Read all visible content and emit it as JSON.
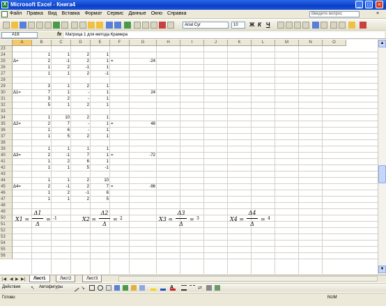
{
  "window": {
    "title": "Microsoft Excel - Книга4",
    "app_icon": "excel-icon"
  },
  "menu": {
    "items": [
      "Файл",
      "Правка",
      "Вид",
      "Вставка",
      "Формат",
      "Сервис",
      "Данные",
      "Окно",
      "Справка"
    ],
    "help_placeholder": "Введите вопрос"
  },
  "toolbar": {
    "font": "Arial Cyr",
    "size": "10"
  },
  "formula_bar": {
    "name_box": "A16",
    "fx": "fx",
    "content": "Матрица 1 для метода Крамера"
  },
  "columns": [
    "A",
    "B",
    "C",
    "D",
    "E",
    "F",
    "G",
    "H",
    "I",
    "J",
    "K",
    "L",
    "M",
    "N",
    "O"
  ],
  "rows": [
    "23",
    "24",
    "25",
    "26",
    "27",
    "28",
    "29",
    "30",
    "31",
    "32",
    "33",
    "34",
    "35",
    "36",
    "37",
    "38",
    "39",
    "40",
    "41",
    "42",
    "43",
    "44",
    "45",
    "46",
    "47",
    "48",
    "49",
    "50",
    "51",
    "52",
    "53",
    "54",
    "55",
    "56"
  ],
  "cells": [
    {
      "r": 1,
      "c": 1,
      "v": "1"
    },
    {
      "r": 1,
      "c": 2,
      "v": "1"
    },
    {
      "r": 1,
      "c": 3,
      "v": "2"
    },
    {
      "r": 1,
      "c": 4,
      "v": "1"
    },
    {
      "r": 2,
      "c": 0,
      "v": "Δ="
    },
    {
      "r": 2,
      "c": 1,
      "v": "2"
    },
    {
      "r": 2,
      "c": 2,
      "v": "-1"
    },
    {
      "r": 2,
      "c": 3,
      "v": "2"
    },
    {
      "r": 2,
      "c": 4,
      "v": "1"
    },
    {
      "r": 2,
      "c": 5,
      "v": "="
    },
    {
      "r": 2,
      "c": 6,
      "v": "-24"
    },
    {
      "r": 3,
      "c": 1,
      "v": "1"
    },
    {
      "r": 3,
      "c": 2,
      "v": "2"
    },
    {
      "r": 3,
      "c": 3,
      "v": "-1"
    },
    {
      "r": 3,
      "c": 4,
      "v": "1"
    },
    {
      "r": 4,
      "c": 1,
      "v": "1"
    },
    {
      "r": 4,
      "c": 2,
      "v": "1"
    },
    {
      "r": 4,
      "c": 3,
      "v": "2"
    },
    {
      "r": 4,
      "c": 4,
      "v": "-1"
    },
    {
      "r": 6,
      "c": 1,
      "v": "3"
    },
    {
      "r": 6,
      "c": 2,
      "v": "1"
    },
    {
      "r": 6,
      "c": 3,
      "v": "2"
    },
    {
      "r": 6,
      "c": 4,
      "v": "1"
    },
    {
      "r": 7,
      "c": 0,
      "v": "Δ1="
    },
    {
      "r": 7,
      "c": 1,
      "v": "7"
    },
    {
      "r": 7,
      "c": 2,
      "v": "1"
    },
    {
      "r": 7,
      "c": 3,
      "v": "-"
    },
    {
      "r": 7,
      "c": 4,
      "v": "1"
    },
    {
      "r": 7,
      "c": 6,
      "v": "24"
    },
    {
      "r": 8,
      "c": 1,
      "v": "3"
    },
    {
      "r": 8,
      "c": 2,
      "v": "2"
    },
    {
      "r": 8,
      "c": 3,
      "v": "-"
    },
    {
      "r": 8,
      "c": 4,
      "v": "1"
    },
    {
      "r": 9,
      "c": 1,
      "v": "5"
    },
    {
      "r": 9,
      "c": 2,
      "v": "1"
    },
    {
      "r": 9,
      "c": 3,
      "v": "2"
    },
    {
      "r": 9,
      "c": 4,
      "v": "1"
    },
    {
      "r": 11,
      "c": 1,
      "v": "1"
    },
    {
      "r": 11,
      "c": 2,
      "v": "10"
    },
    {
      "r": 11,
      "c": 3,
      "v": "2"
    },
    {
      "r": 11,
      "c": 4,
      "v": "1"
    },
    {
      "r": 12,
      "c": 0,
      "v": "Δ2="
    },
    {
      "r": 12,
      "c": 1,
      "v": "2"
    },
    {
      "r": 12,
      "c": 2,
      "v": "7"
    },
    {
      "r": 12,
      "c": 3,
      "v": "-"
    },
    {
      "r": 12,
      "c": 4,
      "v": "1"
    },
    {
      "r": 12,
      "c": 5,
      "v": "="
    },
    {
      "r": 12,
      "c": 6,
      "v": "48"
    },
    {
      "r": 13,
      "c": 1,
      "v": "1"
    },
    {
      "r": 13,
      "c": 2,
      "v": "6"
    },
    {
      "r": 13,
      "c": 3,
      "v": "-"
    },
    {
      "r": 13,
      "c": 4,
      "v": "1"
    },
    {
      "r": 14,
      "c": 1,
      "v": "1"
    },
    {
      "r": 14,
      "c": 2,
      "v": "5"
    },
    {
      "r": 14,
      "c": 3,
      "v": "2"
    },
    {
      "r": 14,
      "c": 4,
      "v": "1"
    },
    {
      "r": 16,
      "c": 1,
      "v": "1"
    },
    {
      "r": 16,
      "c": 2,
      "v": "1"
    },
    {
      "r": 16,
      "c": 3,
      "v": "1"
    },
    {
      "r": 16,
      "c": 4,
      "v": "1"
    },
    {
      "r": 17,
      "c": 0,
      "v": "Δ3="
    },
    {
      "r": 17,
      "c": 1,
      "v": "2"
    },
    {
      "r": 17,
      "c": 2,
      "v": "-1"
    },
    {
      "r": 17,
      "c": 3,
      "v": "7"
    },
    {
      "r": 17,
      "c": 4,
      "v": "1"
    },
    {
      "r": 17,
      "c": 5,
      "v": "="
    },
    {
      "r": 17,
      "c": 6,
      "v": "-72"
    },
    {
      "r": 18,
      "c": 1,
      "v": "1"
    },
    {
      "r": 18,
      "c": 2,
      "v": "2"
    },
    {
      "r": 18,
      "c": 3,
      "v": "6"
    },
    {
      "r": 18,
      "c": 4,
      "v": "1"
    },
    {
      "r": 19,
      "c": 1,
      "v": "1"
    },
    {
      "r": 19,
      "c": 2,
      "v": "1"
    },
    {
      "r": 19,
      "c": 3,
      "v": "5"
    },
    {
      "r": 19,
      "c": 4,
      "v": "-1"
    },
    {
      "r": 21,
      "c": 1,
      "v": "1"
    },
    {
      "r": 21,
      "c": 2,
      "v": "1"
    },
    {
      "r": 21,
      "c": 3,
      "v": "2"
    },
    {
      "r": 21,
      "c": 4,
      "v": "10"
    },
    {
      "r": 22,
      "c": 0,
      "v": "Δ4="
    },
    {
      "r": 22,
      "c": 1,
      "v": "2"
    },
    {
      "r": 22,
      "c": 2,
      "v": "-1"
    },
    {
      "r": 22,
      "c": 3,
      "v": "2"
    },
    {
      "r": 22,
      "c": 4,
      "v": "7"
    },
    {
      "r": 22,
      "c": 5,
      "v": "="
    },
    {
      "r": 22,
      "c": 6,
      "v": "-96"
    },
    {
      "r": 23,
      "c": 1,
      "v": "1"
    },
    {
      "r": 23,
      "c": 2,
      "v": "2"
    },
    {
      "r": 23,
      "c": 3,
      "v": "-1"
    },
    {
      "r": 23,
      "c": 4,
      "v": "6"
    },
    {
      "r": 24,
      "c": 1,
      "v": "1"
    },
    {
      "r": 24,
      "c": 2,
      "v": "1"
    },
    {
      "r": 24,
      "c": 3,
      "v": "2"
    },
    {
      "r": 24,
      "c": 4,
      "v": "5"
    }
  ],
  "equations": [
    {
      "lhs": "X1 =",
      "num": "Δ1",
      "den": "Δ",
      "eq": "=",
      "val": "-1"
    },
    {
      "lhs": "X2 =",
      "num": "Δ2",
      "den": "Δ",
      "eq": "=",
      "val": "2"
    },
    {
      "lhs": "X3 =",
      "num": "Δ3",
      "den": "Δ",
      "eq": "=",
      "val": "3"
    },
    {
      "lhs": "X4 =",
      "num": "Δ4",
      "den": "Δ",
      "eq": "=",
      "val": "4"
    }
  ],
  "sheets": {
    "tabs": [
      "Лист1",
      "Лист2",
      "Лист3"
    ],
    "active": "Лист1"
  },
  "drawbar": {
    "actions": "Действия",
    "autoshapes": "Автофигуры"
  },
  "status": {
    "ready": "Готово",
    "num": "NUM"
  }
}
